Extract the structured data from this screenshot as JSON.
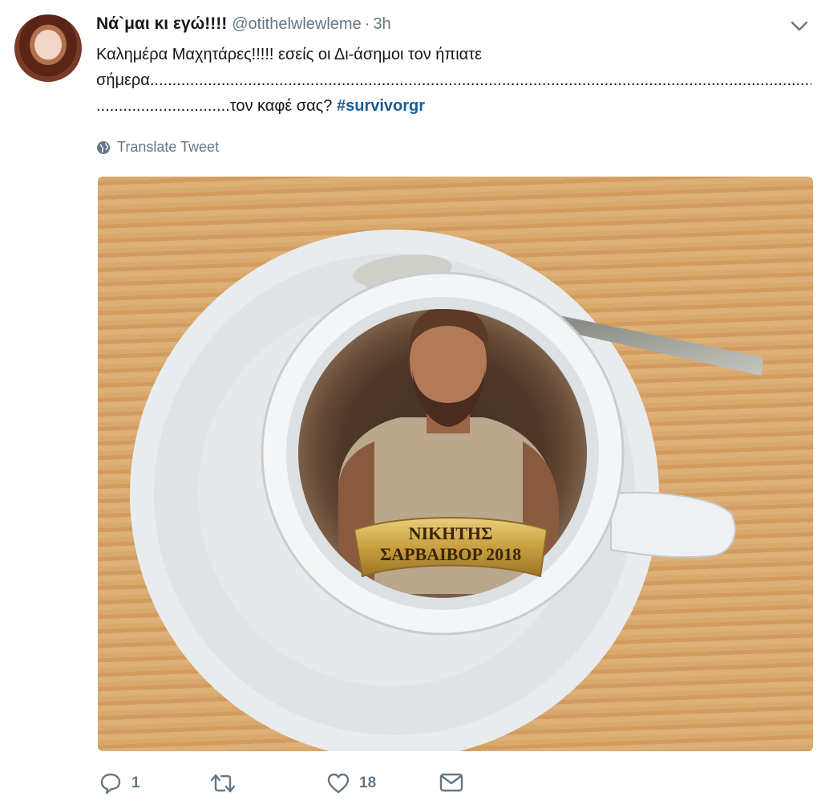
{
  "tweet": {
    "author_name": "Νά`μαι κι εγώ!!!!",
    "author_handle": "@otithelwlewleme",
    "separator": "·",
    "time": "3h",
    "text_line1": "Καλημέρα Μαχητάρες!!!!! εσείς οι Δι-άσημοι τον ήπιατε",
    "text_line2": "σήμερα............................................................................................................................................................................",
    "text_line3_dots": "..............................",
    "text_line3_rest": "τον καφέ σας? ",
    "hashtag": "#survivorgr",
    "translate_label": "Translate Tweet"
  },
  "media": {
    "banner_line1": "ΝΙΚΗΤΗΣ",
    "banner_line2": "ΣΑΡΒΑΙΒΟΡ 2018"
  },
  "actions": {
    "reply_count": "1",
    "retweet_count": "",
    "like_count": "18"
  },
  "icons": [
    "chevron-down-icon",
    "globe-icon",
    "reply-icon",
    "retweet-icon",
    "heart-icon",
    "message-icon"
  ],
  "colors": {
    "hashtag": "#1b5c92",
    "muted": "#657786",
    "text": "#14171a"
  }
}
